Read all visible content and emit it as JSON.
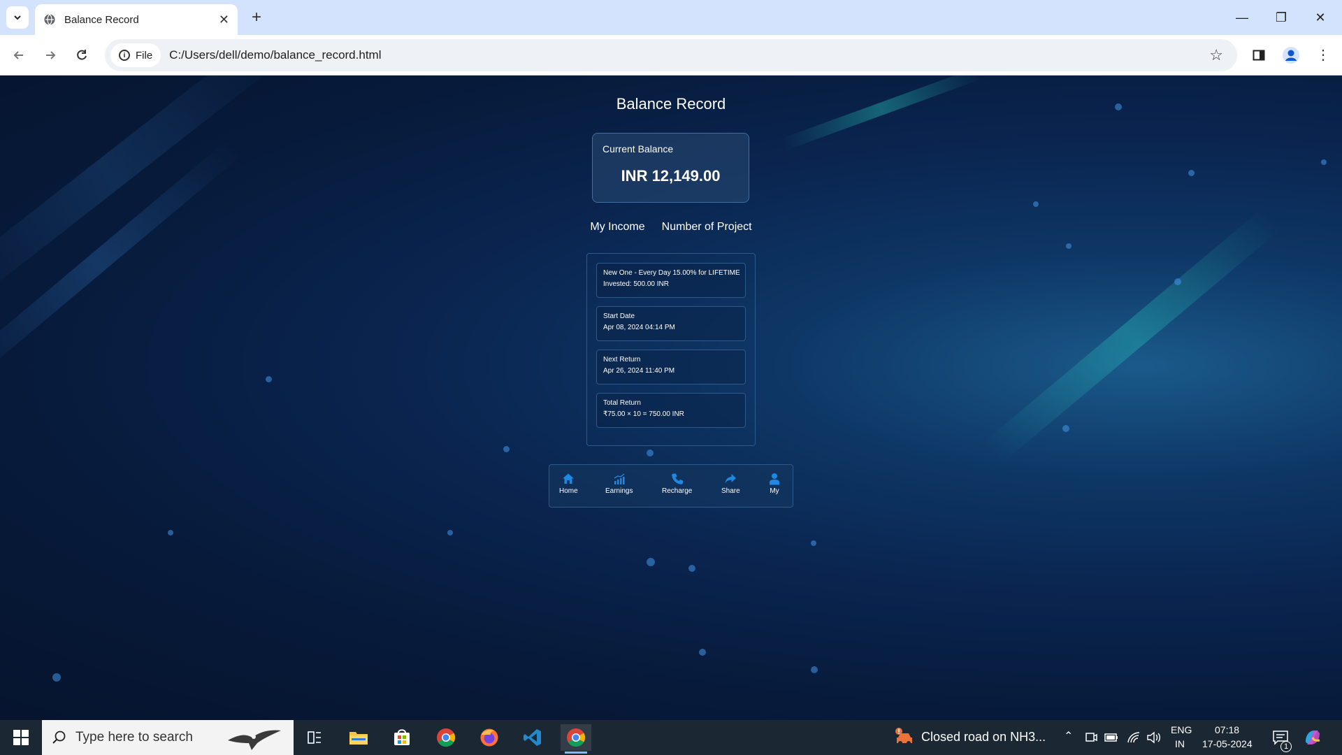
{
  "browser": {
    "tab_title": "Balance Record",
    "address_chip": "File",
    "url": "C:/Users/dell/demo/balance_record.html"
  },
  "page": {
    "title": "Balance Record",
    "balance": {
      "label": "Current Balance",
      "value": "INR 12,149.00"
    },
    "tabs": [
      "My Income",
      "Number of Project"
    ],
    "project": {
      "plan": {
        "line1": "New One - Every Day 15.00% for LIFETIME",
        "line2": "Invested: 500.00 INR"
      },
      "start": {
        "label": "Start Date",
        "value": "Apr 08, 2024 04:14 PM"
      },
      "next": {
        "label": "Next Return",
        "value": "Apr 26, 2024 11:40 PM"
      },
      "total": {
        "label": "Total Return",
        "value": "₹75.00 × 10 = 750.00 INR"
      }
    },
    "nav": [
      {
        "label": "Home",
        "icon": "home-icon"
      },
      {
        "label": "Earnings",
        "icon": "chart-icon"
      },
      {
        "label": "Recharge",
        "icon": "phone-icon"
      },
      {
        "label": "Share",
        "icon": "share-icon"
      },
      {
        "label": "My",
        "icon": "user-icon"
      }
    ],
    "accent_color": "#1e88e5"
  },
  "taskbar": {
    "search_placeholder": "Type here to search",
    "notification": "Closed road on NH3...",
    "lang": "ENG",
    "region": "IN",
    "time": "07:18",
    "date": "17-05-2024",
    "notif_count": "1"
  }
}
